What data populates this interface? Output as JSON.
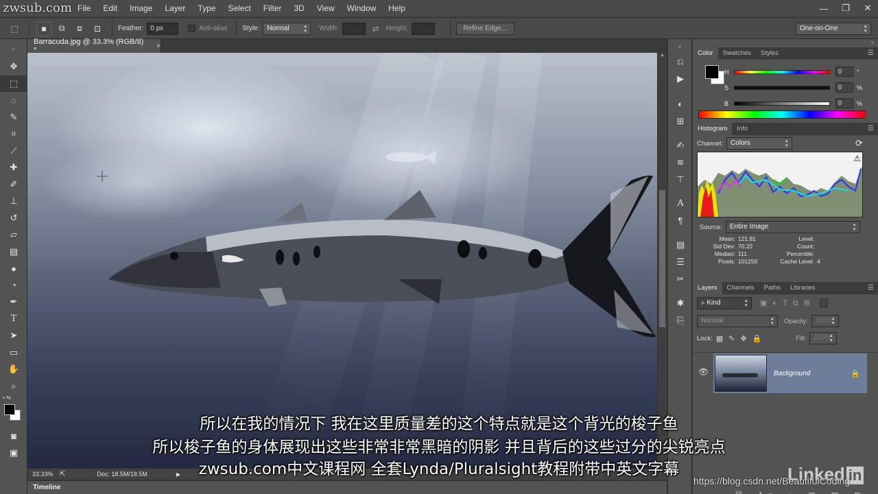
{
  "menu": [
    "File",
    "Edit",
    "Image",
    "Layer",
    "Type",
    "Select",
    "Filter",
    "3D",
    "View",
    "Window",
    "Help"
  ],
  "window_controls": [
    "—",
    "❐",
    "✕"
  ],
  "options": {
    "feather_label": "Feather:",
    "feather_value": "0 px",
    "antialias_label": "Anti-alias",
    "style_label": "Style:",
    "style_value": "Normal",
    "width_label": "Width:",
    "height_label": "Height:",
    "refine_edge": "Refine Edge...",
    "workspace": "One-on-One"
  },
  "document": {
    "tab_title": "Barracuda.jpg @ 33.3% (RGB/8) *",
    "close": "×",
    "zoom": "33.33%",
    "doc_size": "Doc: 18.5M/18.5M"
  },
  "timeline_label": "Timeline",
  "color_panel": {
    "tabs": [
      "Color",
      "Swatches",
      "Styles"
    ],
    "channels": [
      {
        "label": "H",
        "value": "0",
        "unit": "°"
      },
      {
        "label": "S",
        "value": "0",
        "unit": "%"
      },
      {
        "label": "B",
        "value": "0",
        "unit": "%"
      }
    ]
  },
  "histogram_panel": {
    "tabs": [
      "Histogram",
      "Info"
    ],
    "channel_label": "Channel:",
    "channel_value": "Colors",
    "source_label": "Source:",
    "source_value": "Entire Image",
    "stats": {
      "mean_label": "Mean:",
      "mean": "121.81",
      "stddev_label": "Std Dev:",
      "stddev": "70.22",
      "median_label": "Median:",
      "median": "111",
      "pixels_label": "Pixels:",
      "pixels": "101250",
      "level_label": "Level:",
      "level": "",
      "count_label": "Count:",
      "count": "",
      "percentile_label": "Percentile:",
      "percentile": "",
      "cache_label": "Cache Level:",
      "cache": "4"
    }
  },
  "layers_panel": {
    "tabs": [
      "Layers",
      "Channels",
      "Paths",
      "Libraries"
    ],
    "kind_label": "Kind",
    "blend_mode": "Normal",
    "opacity_label": "Opacity:",
    "opacity_value": "100%",
    "lock_label": "Lock:",
    "fill_label": "Fill:",
    "fill_value": "100%",
    "layers": [
      {
        "name": "Background",
        "visible": true,
        "locked": true
      }
    ]
  },
  "subtitles": [
    "所以在我的情况下  我在这里质量差的这个特点就是这个背光的梭子鱼",
    "所以梭子鱼的身体展现出这些非常非常黑暗的阴影  并且背后的这些过分的尖锐亮点",
    "zwsub.com中文课程网 全套Lynda/Pluralsight教程附带中英文字幕"
  ],
  "watermarks": {
    "top_left": "zwsub.com",
    "linkedin": "Linked",
    "csdn": "https://blog.csdn.net/BeautifulCoding"
  },
  "colors": {
    "ui_bg": "#535353",
    "ui_dark": "#3c3c3c",
    "layer_selected": "#6e7d9a"
  }
}
